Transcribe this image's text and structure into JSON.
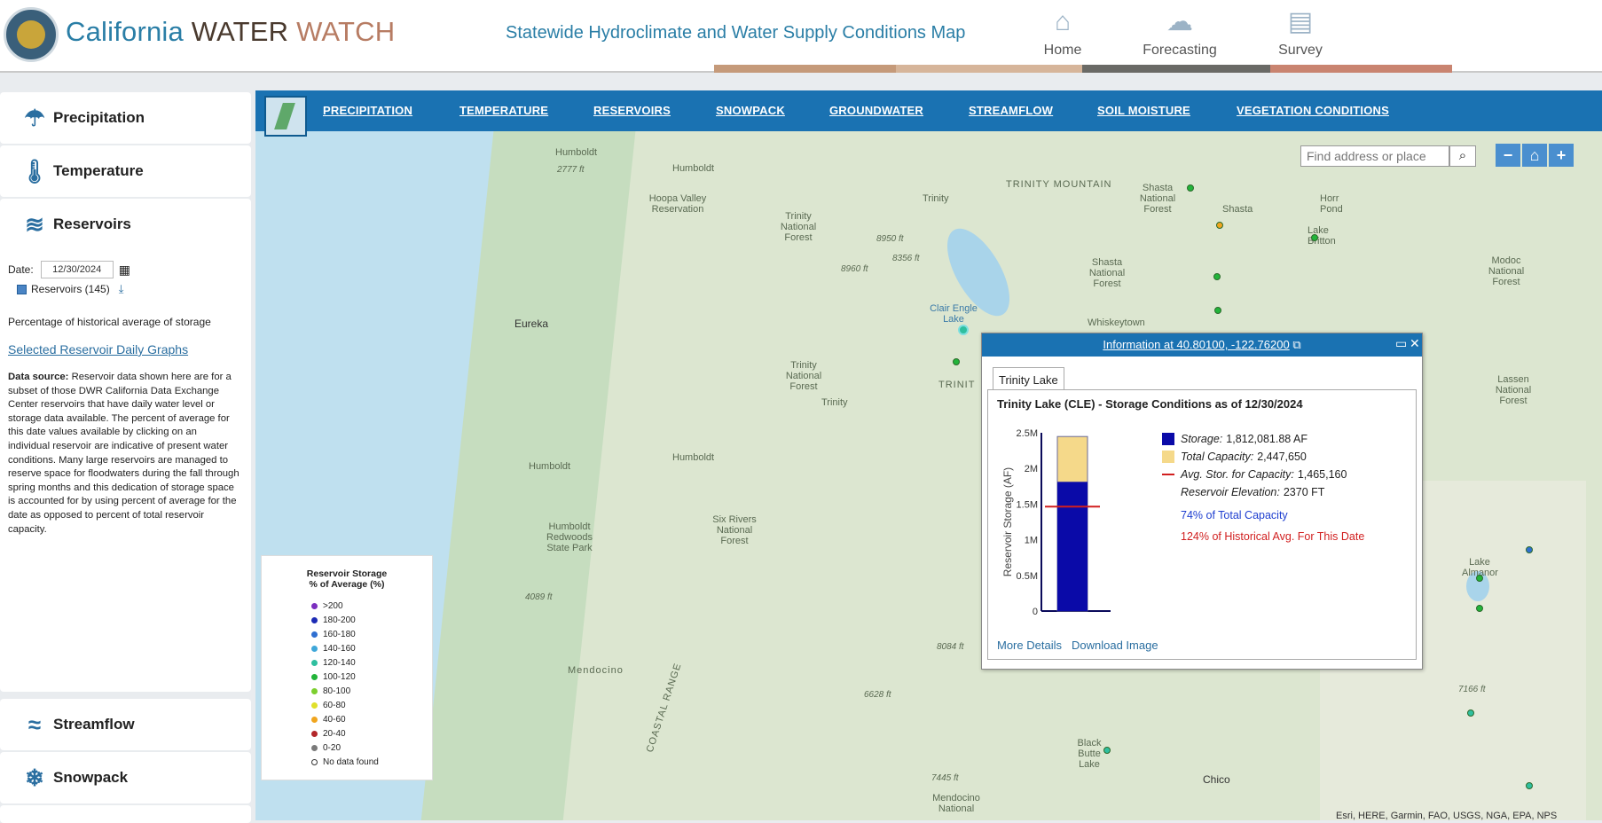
{
  "header": {
    "brand": {
      "part1": "California",
      "part2": "WATER",
      "part3": "WATCH"
    },
    "subtitle": "Statewide Hydroclimate and Water Supply Conditions Map",
    "nav": [
      {
        "label": "Home",
        "icon": "home-icon"
      },
      {
        "label": "Forecasting",
        "icon": "cloud-lightning-icon"
      },
      {
        "label": "Survey",
        "icon": "document-icon"
      }
    ],
    "stripe_colors": [
      "#c59a7a",
      "#d6b59a",
      "#6a6a66",
      "#c98470"
    ]
  },
  "sidebar": {
    "precipitation": "Precipitation",
    "temperature": "Temperature",
    "reservoirs": "Reservoirs",
    "streamflow": "Streamflow",
    "snowpack": "Snowpack",
    "date_label": "Date:",
    "date_value": "12/30/2024",
    "reservoirs_layer": "Reservoirs (145)",
    "pct_text": "Percentage of historical average of storage",
    "graphs_link": "Selected Reservoir Daily Graphs",
    "data_source_label": "Data source:",
    "data_source_text": " Reservoir data shown here are for a subset of those DWR California Data Exchange Center reservoirs that have daily water level or storage data available. The percent of average for this date values available by clicking on an individual reservoir are indicative of present water conditions. Many large reservoirs are managed to reserve space for floodwaters during the fall through spring months and this dedication of storage space is accounted for by using percent of average for the date as opposed to percent of total reservoir capacity."
  },
  "map": {
    "nav_links": [
      "PRECIPITATION",
      "TEMPERATURE",
      "RESERVOIRS",
      "SNOWPACK",
      "GROUNDWATER",
      "STREAMFLOW",
      "SOIL MOISTURE",
      "VEGETATION CONDITIONS"
    ],
    "search_placeholder": "Find address or place",
    "labels": {
      "humboldt1": "Humboldt",
      "ft2777": "2777 ft",
      "humboldt2": "Humboldt",
      "hoopa": "Hoopa Valley Reservation",
      "trinity_nf1": "Trinity National Forest",
      "trinity1": "Trinity",
      "trinity_mtn": "TRINITY MOUNTAIN",
      "shasta_nf": "Shasta National Forest",
      "shasta": "Shasta",
      "horr": "Horr Pond",
      "ft8950": "8950 ft",
      "ft8356": "8356 ft",
      "ft8960": "8960 ft",
      "shasta_nf2": "Shasta National Forest",
      "lake_britton": "Lake Britton",
      "modoc": "Modoc National Forest",
      "eureka": "Eureka",
      "clair": "Clair Engle Lake",
      "whiskeytown": "Whiskeytown",
      "trinity_nf2": "Trinity National Forest",
      "trinity2": "TRINIT",
      "trinity3": "Trinity",
      "lassen": "Lassen National Forest",
      "humboldt3": "Humboldt",
      "humboldt4": "Humboldt",
      "redwoods": "Humboldt Redwoods State Park",
      "six_rivers": "Six Rivers National Forest",
      "ft4089": "4089 ft",
      "mendocino": "Mendocino",
      "coastal": "COASTAL RANGE",
      "ft6628": "6628 ft",
      "ft8084": "8084 ft",
      "ft7445": "7445 ft",
      "mendocino_nf": "Mendocino National",
      "black_butte": "Black Butte Lake",
      "chico": "Chico",
      "lake_almanor": "Lake Almanor",
      "ft7166": "7166 ft",
      "attribution": "Esri, HERE, Garmin, FAO, USGS, NGA, EPA, NPS"
    }
  },
  "legend": {
    "title_line1": "Reservoir Storage",
    "title_line2": "% of Average (%)",
    "items": [
      {
        "label": ">200",
        "color": "#7b2fbf"
      },
      {
        "label": "180-200",
        "color": "#1c2bb5"
      },
      {
        "label": "160-180",
        "color": "#2f6fd1"
      },
      {
        "label": "140-160",
        "color": "#3fa7d9"
      },
      {
        "label": "120-140",
        "color": "#2fbf9f"
      },
      {
        "label": "100-120",
        "color": "#22b43a"
      },
      {
        "label": "80-100",
        "color": "#7ccf2e"
      },
      {
        "label": "60-80",
        "color": "#e0e02a"
      },
      {
        "label": "40-60",
        "color": "#f0a51e"
      },
      {
        "label": "20-40",
        "color": "#b3262a"
      },
      {
        "label": "0-20",
        "color": "#7a7a7a"
      },
      {
        "label": "No data found",
        "color": "#ffffff"
      }
    ]
  },
  "popup": {
    "title": "Information at 40.80100, -122.76200",
    "tab": "Trinity Lake",
    "heading": "Trinity Lake (CLE) - Storage Conditions as of 12/30/2024",
    "storage_label": "Storage:",
    "storage_value": "1,812,081.88 AF",
    "capacity_label": "Total Capacity:",
    "capacity_value": "2,447,650",
    "avg_label": "Avg. Stor. for Capacity:",
    "avg_value": "1,465,160",
    "elev_label": "Reservoir Elevation:",
    "elev_value": "2370 FT",
    "pct_capacity": "74% of Total Capacity",
    "pct_hist": "124% of Historical Avg. For This Date",
    "more_details": "More Details",
    "download": "Download Image",
    "colors": {
      "storage": "#0a0aa8",
      "capacity": "#f5d98a",
      "avg": "#d11f1f",
      "pct_capacity": "#1f3fd0",
      "pct_hist": "#d11f1f"
    }
  },
  "chart_data": {
    "type": "bar",
    "ylabel": "Reservoir Storage (AF)",
    "yticks": [
      "0",
      "0.5M",
      "1M",
      "1.5M",
      "2M",
      "2.5M"
    ],
    "ylim": [
      0,
      2500000
    ],
    "storage": 1812081.88,
    "capacity": 2447650,
    "avg": 1465160
  }
}
